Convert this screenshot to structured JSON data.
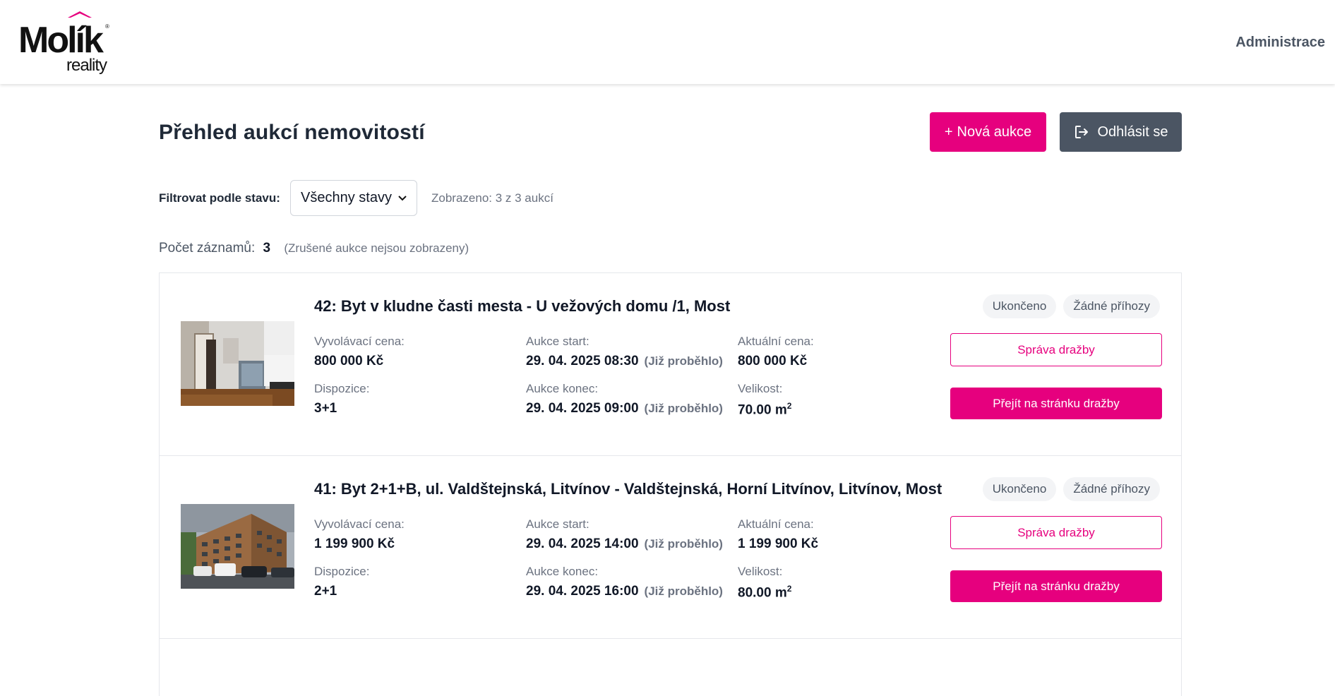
{
  "header": {
    "logo_text": "Molík",
    "logo_subtext": "reality",
    "admin_link": "Administrace"
  },
  "page": {
    "title": "Přehled aukcí nemovitostí",
    "new_auction_button": "Nová aukce",
    "new_auction_prefix": "+",
    "logout_button": "Odhlásit se"
  },
  "filter": {
    "label": "Filtrovat podle stavu:",
    "selected": "Všechny stavy",
    "shown": "Zobrazeno: 3 z 3 aukcí"
  },
  "records": {
    "label": "Počet záznamů:",
    "count": "3",
    "note": "(Zrušené aukce nejsou zobrazeny)"
  },
  "labels": {
    "starting_price": "Vyvolávací cena:",
    "auction_start": "Aukce start:",
    "current_price": "Aktuální cena:",
    "layout": "Dispozice:",
    "auction_end": "Aukce konec:",
    "size": "Velikost:",
    "past_note": "(Již proběhlo)",
    "manage_button": "Správa dražby",
    "go_button": "Přejít na stránku dražby",
    "size_unit_sup": "2"
  },
  "auctions": [
    {
      "title": "42: Byt v kludne časti mesta - U vežových domu /1, Most",
      "status": "Ukončeno",
      "bids": "Žádné příhozy",
      "starting_price": "800 000 Kč",
      "start": "29. 04. 2025 08:30",
      "current_price": "800 000 Kč",
      "layout": "3+1",
      "end": "29. 04. 2025 09:00",
      "size": "70.00 m"
    },
    {
      "title": "41: Byt 2+1+B, ul. Valdštejnská, Litvínov - Valdštejnská, Horní Litvínov, Litvínov, Most",
      "status": "Ukončeno",
      "bids": "Žádné příhozy",
      "starting_price": "1 199 900 Kč",
      "start": "29. 04. 2025 14:00",
      "current_price": "1 199 900 Kč",
      "layout": "2+1",
      "end": "29. 04. 2025 16:00",
      "size": "80.00 m"
    }
  ],
  "colors": {
    "brand": "#e6007e",
    "logout": "#4b5563"
  }
}
